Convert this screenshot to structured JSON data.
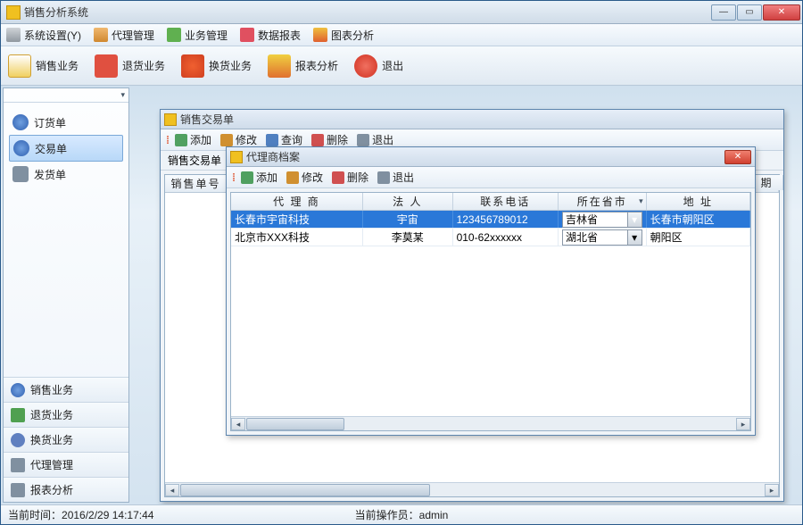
{
  "app": {
    "title": "销售分析系统"
  },
  "menubar": [
    {
      "label": "系统设置(Y)",
      "icon": "c-gear",
      "name": "menu-system-settings"
    },
    {
      "label": "代理管理",
      "icon": "c-people",
      "name": "menu-agent-manage"
    },
    {
      "label": "业务管理",
      "icon": "c-biz",
      "name": "menu-business-manage"
    },
    {
      "label": "数据报表",
      "icon": "c-table",
      "name": "menu-data-report"
    },
    {
      "label": "图表分析",
      "icon": "c-chart",
      "name": "menu-chart-analysis"
    }
  ],
  "maintoolbar": [
    {
      "label": "销售业务",
      "icon": "c-doc",
      "name": "tool-sales"
    },
    {
      "label": "退货业务",
      "icon": "c-ret",
      "name": "tool-returns"
    },
    {
      "label": "换货业务",
      "icon": "c-swap",
      "name": "tool-exchange"
    },
    {
      "label": "报表分析",
      "icon": "c-rep",
      "name": "tool-report"
    },
    {
      "label": "退出",
      "icon": "c-exit",
      "name": "tool-exit"
    }
  ],
  "sidebar": {
    "nav": [
      {
        "label": "订货单",
        "icon": "c-globe",
        "name": "nav-order",
        "selected": false
      },
      {
        "label": "交易单",
        "icon": "c-globe",
        "name": "nav-transaction",
        "selected": true
      },
      {
        "label": "发货单",
        "icon": "c-wrench",
        "name": "nav-shipment",
        "selected": false
      }
    ],
    "buttons": [
      {
        "label": "销售业务",
        "name": "sidebtn-sales"
      },
      {
        "label": "退货业务",
        "name": "sidebtn-returns"
      },
      {
        "label": "换货业务",
        "name": "sidebtn-exchange"
      },
      {
        "label": "代理管理",
        "name": "sidebtn-agent"
      },
      {
        "label": "报表分析",
        "name": "sidebtn-report"
      }
    ]
  },
  "windows": {
    "transaction": {
      "title": "销售交易单",
      "toolbar": [
        {
          "label": "添加",
          "icon": "c-add",
          "name": "trans-add"
        },
        {
          "label": "修改",
          "icon": "c-edit",
          "name": "trans-edit"
        },
        {
          "label": "查询",
          "icon": "c-find",
          "name": "trans-query"
        },
        {
          "label": "删除",
          "icon": "c-del",
          "name": "trans-delete"
        },
        {
          "label": "退出",
          "icon": "c-out",
          "name": "trans-exit"
        }
      ],
      "subhead_left": "销售交易单",
      "subhead_label": "销售单号",
      "extra_col": "期"
    },
    "agent": {
      "title": "代理商档案",
      "toolbar": [
        {
          "label": "添加",
          "icon": "c-add",
          "name": "agent-add"
        },
        {
          "label": "修改",
          "icon": "c-edit",
          "name": "agent-edit"
        },
        {
          "label": "删除",
          "icon": "c-del",
          "name": "agent-delete"
        },
        {
          "label": "退出",
          "icon": "c-out",
          "name": "agent-exit"
        }
      ],
      "columns": [
        "代 理 商",
        "法   人",
        "联系电话",
        "所在省市",
        "地   址"
      ],
      "rows": [
        {
          "agent": "长春市宇宙科技",
          "legal": "宇宙",
          "phone": "123456789012",
          "prov": "吉林省",
          "addr": "长春市朝阳区",
          "selected": true
        },
        {
          "agent": "北京市XXX科技",
          "legal": "李莫某",
          "phone": "010-62xxxxxx",
          "prov": "湖北省",
          "addr": "朝阳区",
          "selected": false
        }
      ]
    }
  },
  "status": {
    "time_label": "当前时间：",
    "time_value": "2016/2/29 14:17:44",
    "operator_label": "当前操作员：",
    "operator_value": "admin"
  }
}
